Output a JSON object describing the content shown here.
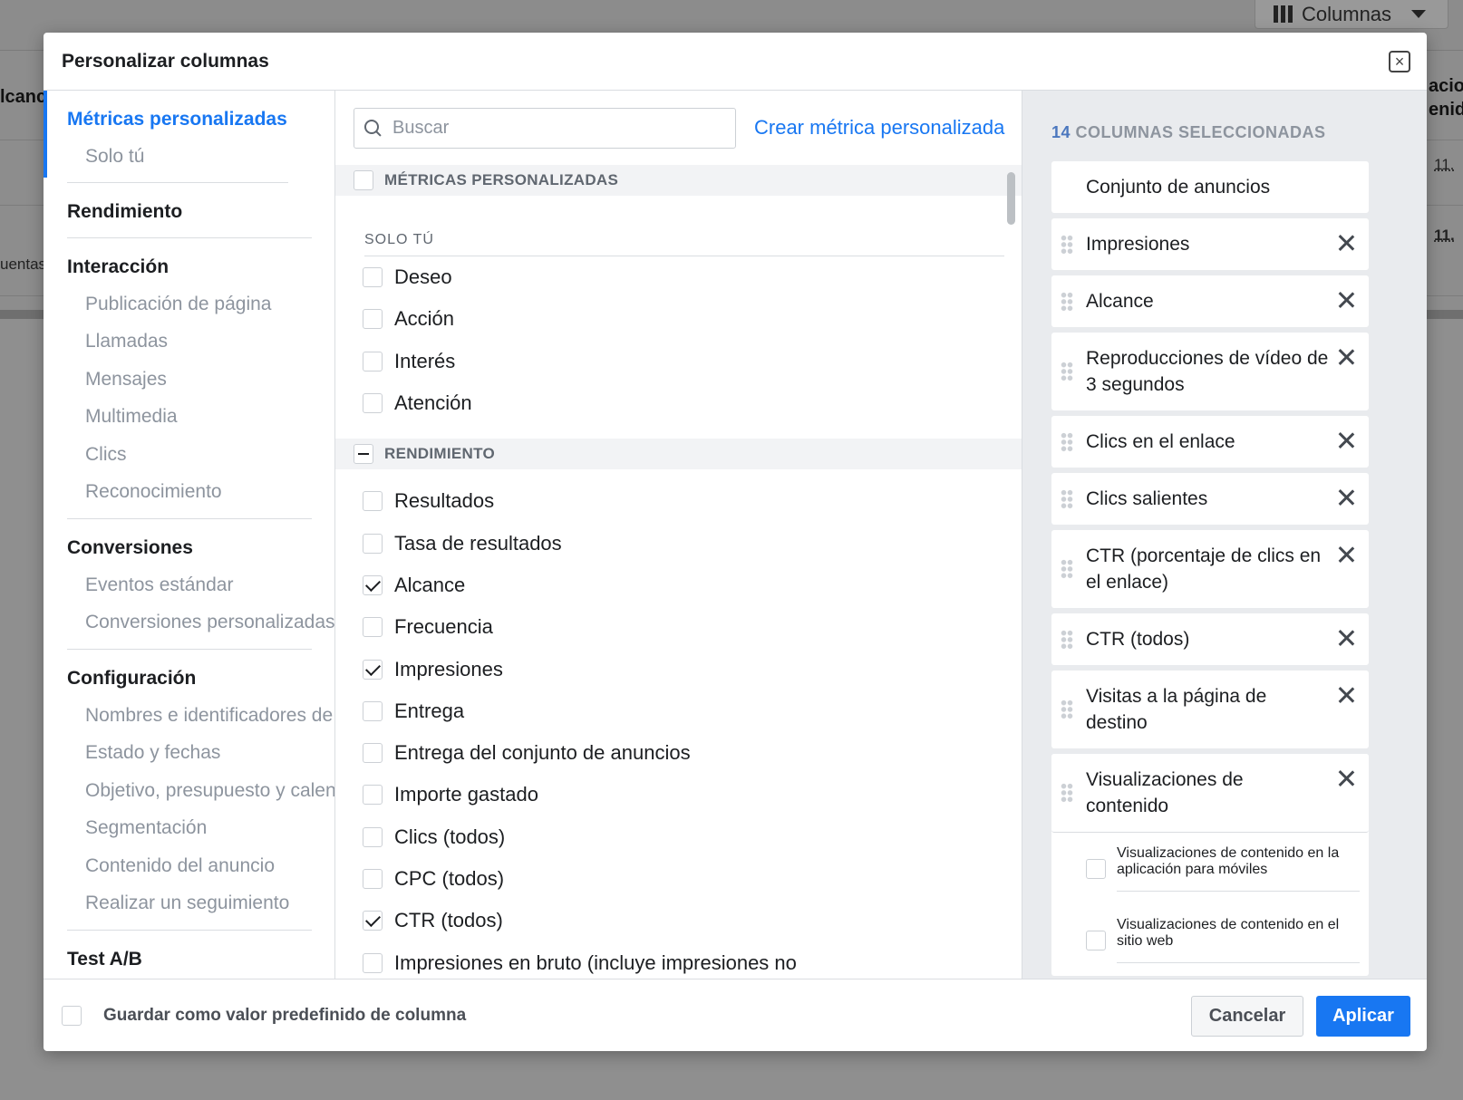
{
  "background": {
    "columns_button_label": "Columnas",
    "header_left_fragment": "lcanc",
    "header_right_fragment_1": "acion",
    "header_right_fragment_2": "enido",
    "row_left_fragment": "uentas",
    "row_value_1": "11.",
    "row_value_2": "11."
  },
  "modal": {
    "title": "Personalizar columnas",
    "close_icon": "close-icon"
  },
  "nav": {
    "groups": [
      {
        "heading": "Métricas personalizadas",
        "active": true,
        "items": [
          "Solo tú"
        ]
      },
      {
        "heading": "Rendimiento",
        "active": false,
        "items": []
      },
      {
        "heading": "Interacción",
        "active": false,
        "items": [
          "Publicación de página",
          "Llamadas",
          "Mensajes",
          "Multimedia",
          "Clics",
          "Reconocimiento"
        ]
      },
      {
        "heading": "Conversiones",
        "active": false,
        "items": [
          "Eventos estándar",
          "Conversiones personalizadas"
        ]
      },
      {
        "heading": "Configuración",
        "active": false,
        "items": [
          "Nombres e identificadores de",
          "Estado y fechas",
          "Objetivo, presupuesto y calendario",
          "Segmentación",
          "Contenido del anuncio",
          "Realizar un seguimiento"
        ]
      },
      {
        "heading": "Test A/B",
        "active": false,
        "items": []
      }
    ]
  },
  "search": {
    "placeholder": "Buscar",
    "value": "",
    "create_link": "Crear métrica personalizada"
  },
  "metrics_list": {
    "section_custom": "MÉTRICAS PERSONALIZADAS",
    "subsection_only_you": "SOLO TÚ",
    "custom_items": [
      {
        "label": "Deseo",
        "checked": false
      },
      {
        "label": "Acción",
        "checked": false
      },
      {
        "label": "Interés",
        "checked": false
      },
      {
        "label": "Atención",
        "checked": false
      }
    ],
    "section_performance": "RENDIMIENTO",
    "performance_items": [
      {
        "label": "Resultados",
        "checked": false
      },
      {
        "label": "Tasa de resultados",
        "checked": false
      },
      {
        "label": "Alcance",
        "checked": true
      },
      {
        "label": "Frecuencia",
        "checked": false
      },
      {
        "label": "Impresiones",
        "checked": true
      },
      {
        "label": "Entrega",
        "checked": false
      },
      {
        "label": "Entrega del conjunto de anuncios",
        "checked": false
      },
      {
        "label": "Importe gastado",
        "checked": false
      },
      {
        "label": "Clics (todos)",
        "checked": false
      },
      {
        "label": "CPC (todos)",
        "checked": false
      },
      {
        "label": "CTR (todos)",
        "checked": true
      },
      {
        "label": "Impresiones en bruto (incluye impresiones no",
        "checked": false
      }
    ]
  },
  "selected": {
    "count": "14",
    "title_suffix": "COLUMNAS SELECCIONADAS",
    "fixed_item": "Conjunto de anuncios",
    "items": [
      "Impresiones",
      "Alcance",
      "Reproducciones de vídeo de 3 segundos",
      "Clics en el enlace",
      "Clics salientes",
      "CTR (porcentaje de clics en el enlace)",
      "CTR (todos)",
      "Visitas a la página de destino"
    ],
    "group": {
      "label": "Visualizaciones de contenido",
      "subitems": [
        "Visualizaciones de contenido en la aplicación para móviles",
        "Visualizaciones de contenido en el sitio web"
      ]
    }
  },
  "footer": {
    "save_preset_label": "Guardar como valor predefinido de columna",
    "save_preset_checked": false,
    "cancel_label": "Cancelar",
    "apply_label": "Aplicar"
  },
  "colors": {
    "accent": "#1877f2",
    "count_color": "#4b77be",
    "overlay": "#8f8f8f"
  }
}
